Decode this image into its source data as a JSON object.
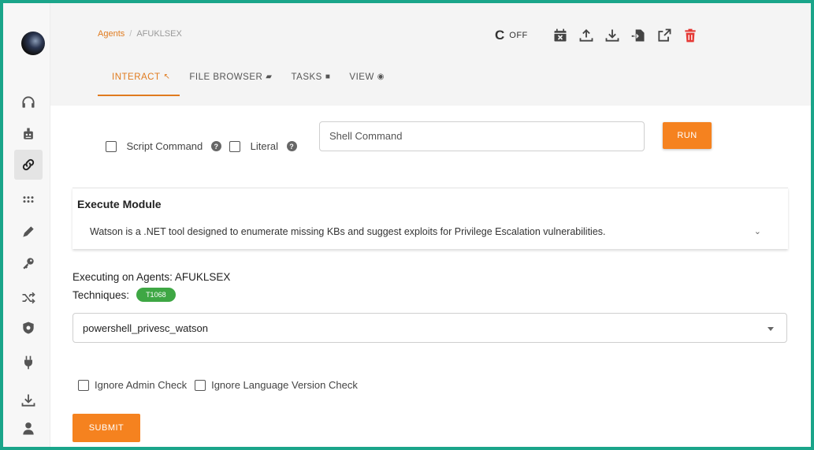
{
  "breadcrumb": {
    "parent": "Agents",
    "separator": "/",
    "current": "AFUKLSEX"
  },
  "toolbar": {
    "refresh_glyph": "C",
    "refresh_state": "OFF",
    "icons": [
      "calendar-x-icon",
      "upload-icon",
      "download-icon",
      "file-import-icon",
      "external-link-icon",
      "trash-icon"
    ],
    "delete_color": "#e53935"
  },
  "tabs": [
    {
      "label": "INTERACT",
      "glyph": "⁠🖱"
    },
    {
      "label": "FILE BROWSER",
      "glyph": "▰"
    },
    {
      "label": "TASKS",
      "glyph": "■"
    },
    {
      "label": "VIEW",
      "glyph": "◉"
    }
  ],
  "command": {
    "script_label": "Script Command",
    "literal_label": "Literal",
    "help_glyph": "?",
    "shell_placeholder": "Shell Command",
    "run_label": "RUN"
  },
  "module": {
    "title": "Execute Module",
    "description": "Watson is a .NET tool designed to enumerate missing KBs and suggest exploits for Privilege Escalation vulnerabilities.",
    "chevron": "⌄"
  },
  "execution": {
    "agents_line": "Executing on Agents: AFUKLSEX",
    "techniques_label": "Techniques:",
    "technique_badge": "T1068",
    "selected_module": "powershell_privesc_watson"
  },
  "options": {
    "ignore_admin": "Ignore Admin Check",
    "ignore_lang": "Ignore Language Version Check"
  },
  "submit_label": "SUBMIT",
  "colors": {
    "accent": "#f5821f",
    "frame": "#1aa58a",
    "badge": "#3ea744"
  }
}
